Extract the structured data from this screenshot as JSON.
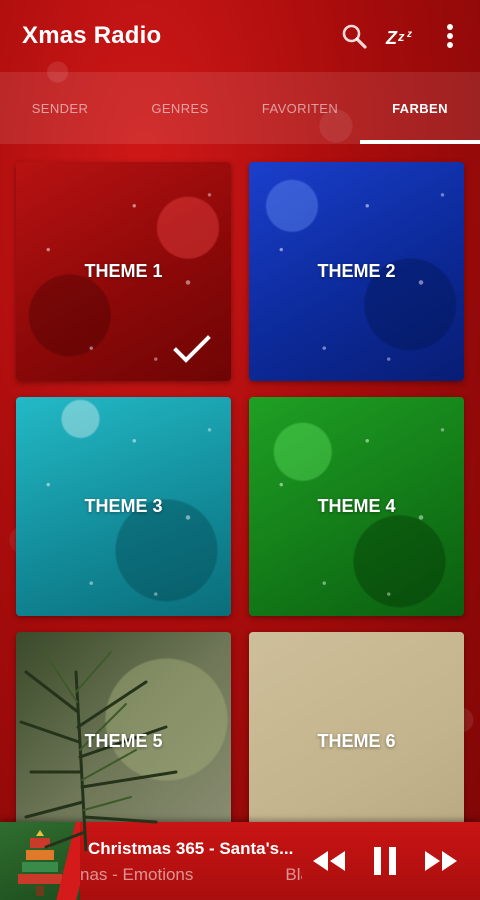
{
  "app": {
    "title": "Xmas Radio"
  },
  "toolbar": {
    "search_icon": "search-icon",
    "sleep_icon": "sleep-timer-icon",
    "sleep_label": "ZZZ",
    "menu_icon": "more-vert-icon"
  },
  "tabs": [
    {
      "label": "SENDER",
      "active": false
    },
    {
      "label": "GENRES",
      "active": false
    },
    {
      "label": "FAVORITEN",
      "active": false
    },
    {
      "label": "FARBEN",
      "active": true
    }
  ],
  "themes": [
    {
      "label": "THEME 1",
      "color": "#a80e0e",
      "selected": true
    },
    {
      "label": "THEME 2",
      "color": "#1132b0",
      "selected": false
    },
    {
      "label": "THEME 3",
      "color": "#1aa3b1",
      "selected": false
    },
    {
      "label": "THEME 4",
      "color": "#178c1c",
      "selected": false
    },
    {
      "label": "THEME 5",
      "color": "#6d7656",
      "selected": false
    },
    {
      "label": "THEME 6",
      "color": "#c6b78f",
      "selected": false
    }
  ],
  "player": {
    "title": "Christmas 365 - Santa's...",
    "subtitle_left": "nas - Emotions",
    "subtitle_right": "Bla",
    "controls": [
      "rewind-icon",
      "pause-icon",
      "fast-forward-icon"
    ]
  },
  "colors": {
    "accent": "#c91414",
    "background": "#a80c0c",
    "text": "#ffffff"
  }
}
